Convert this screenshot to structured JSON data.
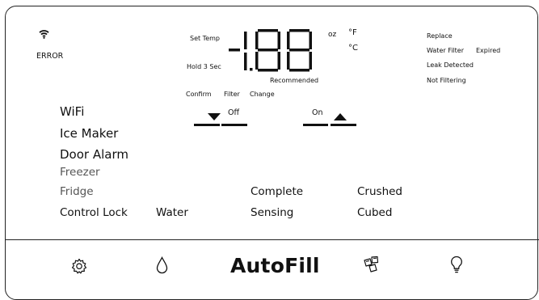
{
  "status": {
    "error_label": "ERROR"
  },
  "temp_area": {
    "set_temp": "Set Temp",
    "hold": "Hold 3 Sec",
    "digits": "-1.88",
    "unit_oz": "oz",
    "unit_f": "°F",
    "unit_c": "°C",
    "recommended": "Recommended"
  },
  "filter_area": {
    "confirm": "Confirm",
    "filter": "Filter",
    "change": "Change",
    "off": "Off",
    "on": "On"
  },
  "alerts": {
    "replace": "Replace",
    "water_filter": "Water Filter",
    "expired": "Expired",
    "leak": "Leak Detected",
    "not_filtering": "Not Filtering"
  },
  "menu": {
    "wifi": "WiFi",
    "ice_maker": "Ice Maker",
    "door_alarm": "Door Alarm",
    "freezer": "Freezer",
    "fridge": "Fridge",
    "control_lock": "Control Lock",
    "water": "Water",
    "complete": "Complete",
    "sensing": "Sensing",
    "crushed": "Crushed",
    "cubed": "Cubed"
  },
  "bottom": {
    "autofill": "AutoFill",
    "icons": [
      "settings-gear-icon",
      "water-drop-icon",
      "ice-cubes-icon",
      "light-bulb-icon"
    ]
  }
}
